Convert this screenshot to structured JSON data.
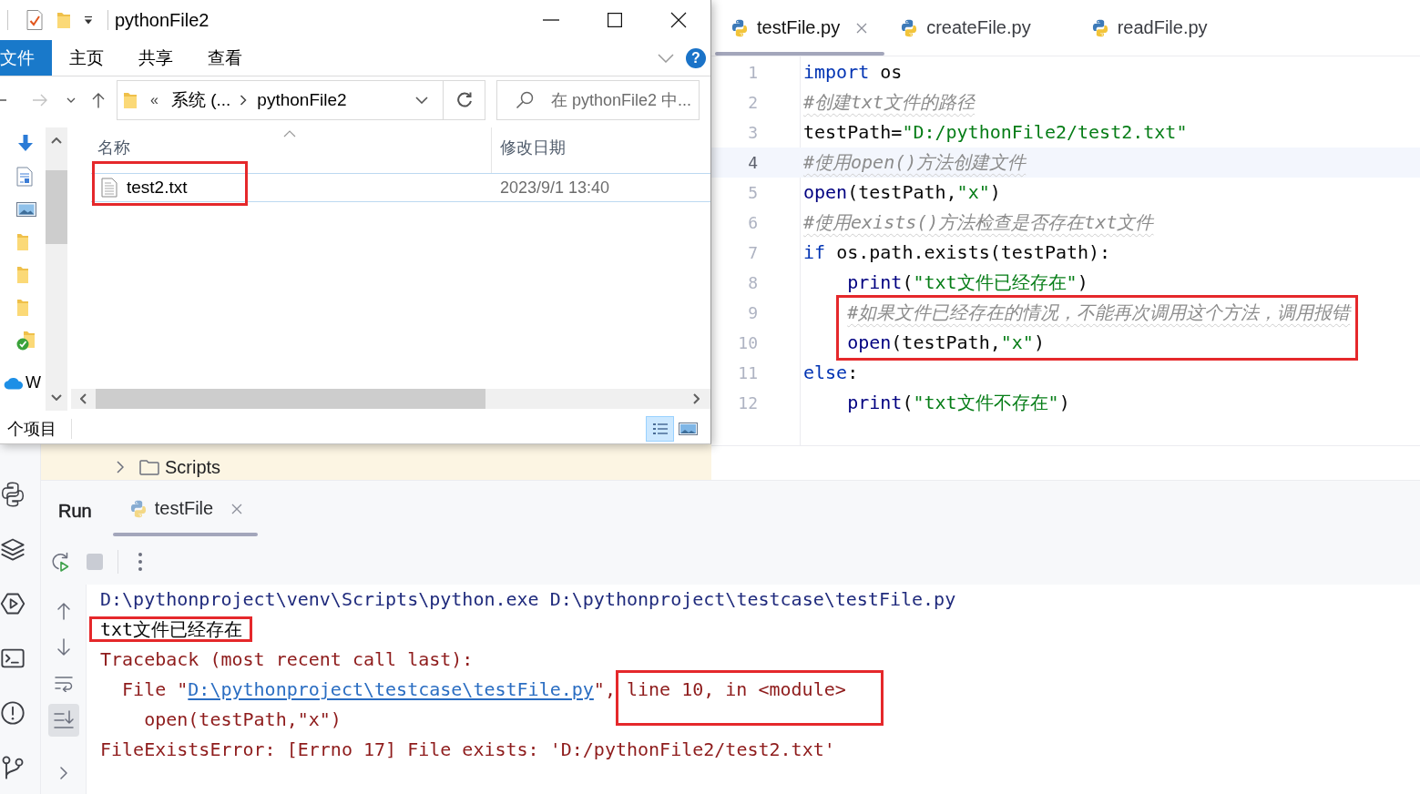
{
  "explorer": {
    "title": "pythonFile2",
    "ribbon_tabs": [
      {
        "label": "文件",
        "selected": true
      },
      {
        "label": "主页",
        "selected": false
      },
      {
        "label": "共享",
        "selected": false
      },
      {
        "label": "查看",
        "selected": false
      }
    ],
    "help": "?",
    "address": {
      "overflow_mark": "«",
      "segments": [
        "系统 (...",
        "pythonFile2"
      ]
    },
    "search": {
      "placeholder": "在 pythonFile2 中..."
    },
    "nav_pane": {
      "cloud_item_label": "W"
    },
    "columns": [
      {
        "label": "名称",
        "sorted": true
      },
      {
        "label": "修改日期",
        "sorted": false
      }
    ],
    "files": [
      {
        "name": "test2.txt",
        "modified": "2023/9/1 13:40",
        "highlighted": true
      }
    ],
    "status": "个项目",
    "view_modes": [
      {
        "kind": "details",
        "selected": true
      },
      {
        "kind": "large_icons",
        "selected": false
      }
    ]
  },
  "ide": {
    "project_tree": {
      "items": [
        {
          "label": "Scripts",
          "expanded": false
        }
      ]
    },
    "editor": {
      "tabs": [
        {
          "label": "testFile.py",
          "selected": true
        },
        {
          "label": "createFile.py",
          "selected": false
        },
        {
          "label": "readFile.py",
          "selected": false
        }
      ],
      "lines": [
        {
          "number": "1",
          "tokens": [
            {
              "kind": "keyword",
              "text": "import"
            },
            {
              "kind": "plain",
              "text": " os"
            }
          ],
          "current": false,
          "highlighted": false
        },
        {
          "number": "2",
          "tokens": [
            {
              "kind": "comment",
              "text": "#创建txt文件的路径"
            }
          ],
          "current": false,
          "highlighted": false
        },
        {
          "number": "3",
          "tokens": [
            {
              "kind": "plain",
              "text": "testPath="
            },
            {
              "kind": "string",
              "text": "\"D:/pythonFile2/test2.txt\""
            }
          ],
          "current": false,
          "highlighted": false
        },
        {
          "number": "4",
          "tokens": [
            {
              "kind": "comment",
              "text": "#使用open()方法创建文件"
            }
          ],
          "current": true,
          "highlighted": false
        },
        {
          "number": "5",
          "tokens": [
            {
              "kind": "call",
              "text": "open"
            },
            {
              "kind": "plain",
              "text": "(testPath,"
            },
            {
              "kind": "string",
              "text": "\"x\""
            },
            {
              "kind": "plain",
              "text": ")"
            }
          ],
          "current": false,
          "highlighted": false
        },
        {
          "number": "6",
          "tokens": [
            {
              "kind": "comment",
              "text": "#使用exists()方法检查是否存在txt文件"
            }
          ],
          "current": false,
          "highlighted": false
        },
        {
          "number": "7",
          "tokens": [
            {
              "kind": "keyword",
              "text": "if"
            },
            {
              "kind": "plain",
              "text": " os.path.exists(testPath):"
            }
          ],
          "current": false,
          "highlighted": false,
          "children": [
            {
              "number": "8",
              "tokens": [
                {
                  "kind": "call",
                  "text": "print"
                },
                {
                  "kind": "plain",
                  "text": "("
                },
                {
                  "kind": "string",
                  "text": "\"txt文件已经存在\""
                },
                {
                  "kind": "plain",
                  "text": ")"
                }
              ],
              "current": false,
              "highlighted": false
            },
            {
              "number": "9",
              "tokens": [
                {
                  "kind": "comment",
                  "text": "#如果文件已经存在的情况，不能再次调用这个方法，调用报错"
                }
              ],
              "current": false,
              "highlighted": true
            },
            {
              "number": "10",
              "tokens": [
                {
                  "kind": "call",
                  "text": "open"
                },
                {
                  "kind": "plain",
                  "text": "(testPath,"
                },
                {
                  "kind": "string",
                  "text": "\"x\""
                },
                {
                  "kind": "plain",
                  "text": ")"
                }
              ],
              "current": false,
              "highlighted": true
            }
          ]
        },
        {
          "number": "11",
          "tokens": [
            {
              "kind": "keyword",
              "text": "else"
            },
            {
              "kind": "plain",
              "text": ":"
            }
          ],
          "current": false,
          "highlighted": false,
          "children": [
            {
              "number": "12",
              "tokens": [
                {
                  "kind": "call",
                  "text": "print"
                },
                {
                  "kind": "plain",
                  "text": "("
                },
                {
                  "kind": "string",
                  "text": "\"txt文件不存在\""
                },
                {
                  "kind": "plain",
                  "text": ")"
                }
              ],
              "current": false,
              "highlighted": false
            }
          ]
        }
      ]
    },
    "run": {
      "title": "Run",
      "tabs": [
        {
          "label": "testFile",
          "selected": true
        }
      ],
      "auto_scroll": {
        "on": true
      },
      "console": [
        {
          "kind": "command",
          "text": "D:\\pythonproject\\venv\\Scripts\\python.exe D:\\pythonproject\\testcase\\testFile.py",
          "highlighted": false
        },
        {
          "kind": "output",
          "text": "txt文件已经存在",
          "highlighted": true
        },
        {
          "kind": "error",
          "text": "Traceback (most recent call last):",
          "highlighted": false
        },
        {
          "kind": "trace",
          "prefix": "File \"",
          "link": "D:\\pythonproject\\testcase\\testFile.py",
          "suffix": "\",",
          "detail": "line 10, in <module>",
          "highlighted": true
        },
        {
          "kind": "code",
          "text": "open(testPath,\"x\")",
          "highlighted": false
        },
        {
          "kind": "error",
          "text": "FileExistsError: [Errno 17] File exists: 'D:/pythonFile2/test2.txt'",
          "highlighted": false
        }
      ]
    }
  }
}
